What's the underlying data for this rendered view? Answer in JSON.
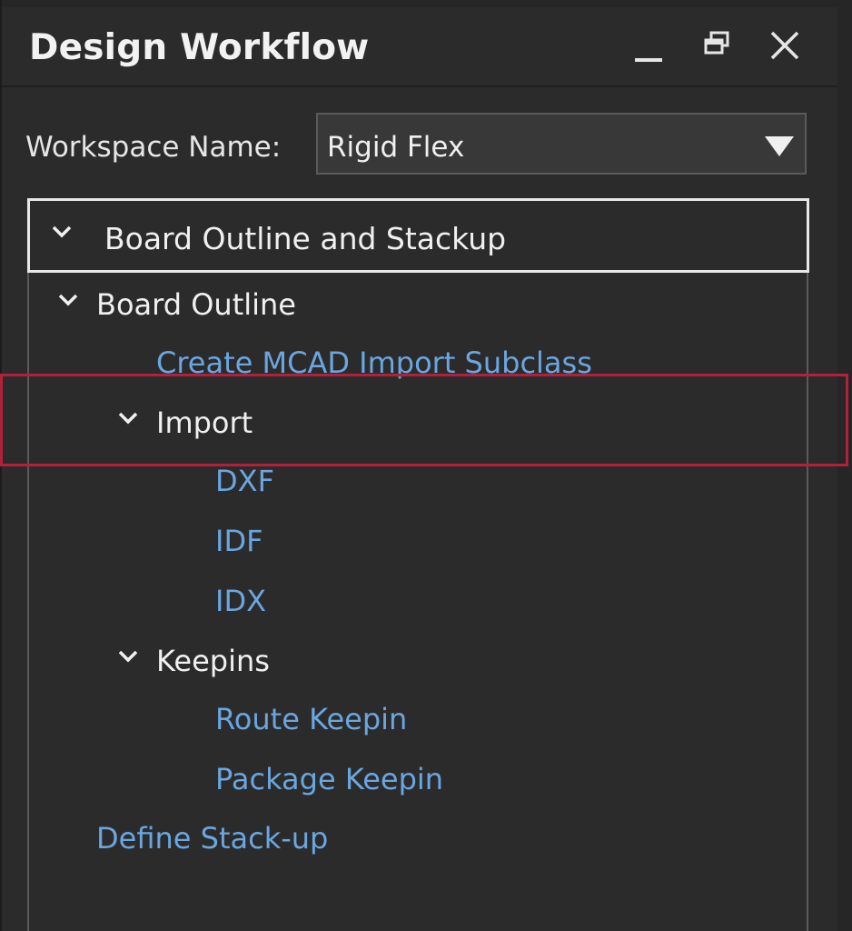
{
  "panel": {
    "title": "Design Workflow"
  },
  "workspace": {
    "label": "Workspace Name:",
    "selected": "Rigid Flex"
  },
  "tree": {
    "section": "Board Outline and Stackup",
    "board_outline": "Board Outline",
    "create_mcad": "Create MCAD Import Subclass",
    "import": "Import",
    "dxf": "DXF",
    "idf": "IDF",
    "idx": "IDX",
    "keepins": "Keepins",
    "route_keepin": "Route Keepin",
    "package_keepin": "Package Keepin",
    "define_stackup": "Define Stack-up"
  },
  "colors": {
    "background": "#2b2b2b",
    "text": "#f0f0f0",
    "link": "#6aa6e0",
    "highlight": "#b3203a"
  }
}
